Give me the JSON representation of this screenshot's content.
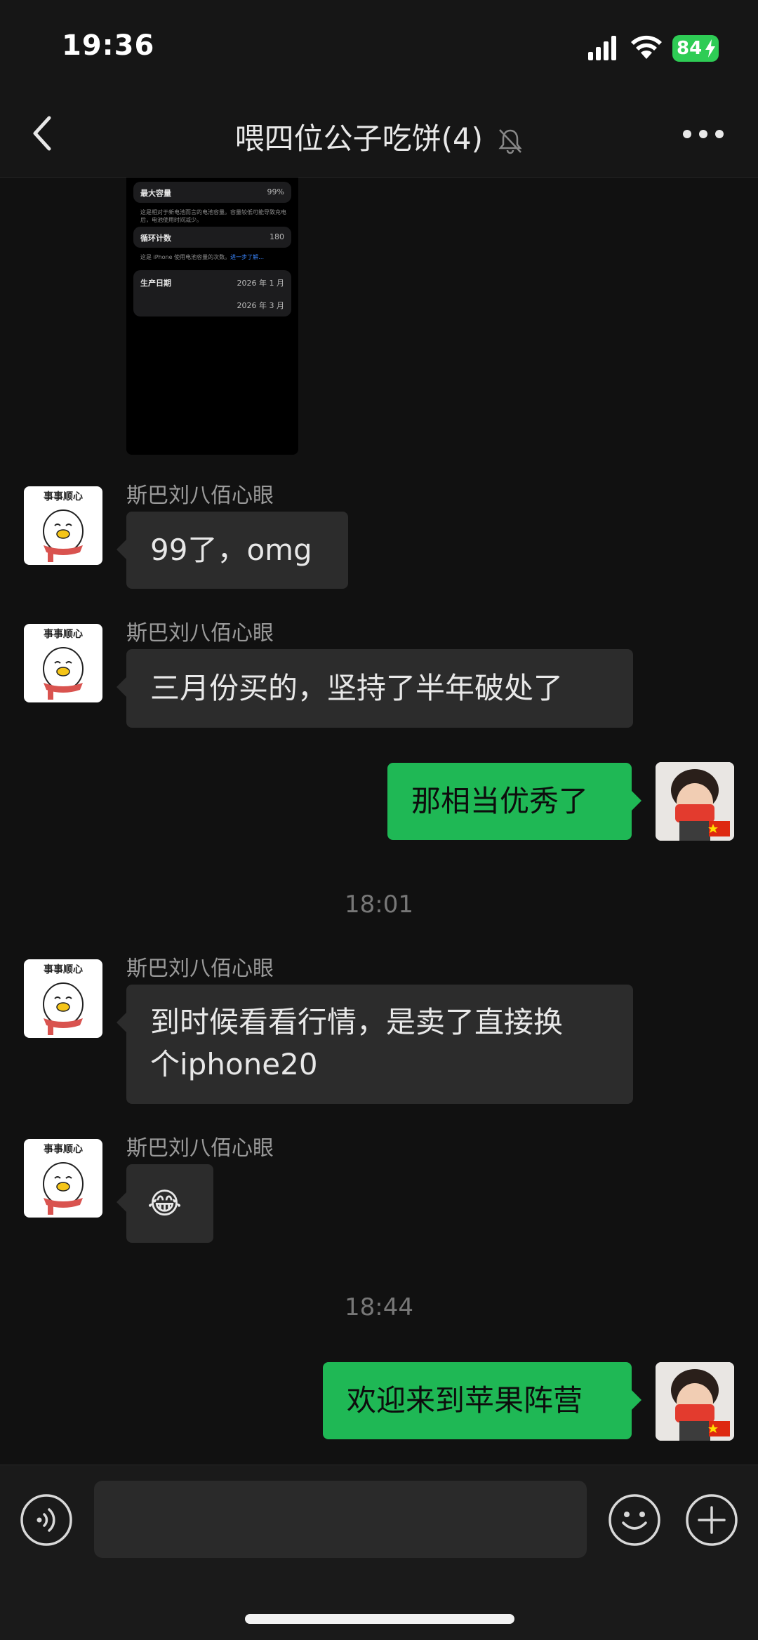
{
  "status": {
    "time": "19:36",
    "battery": "84"
  },
  "header": {
    "title": "喂四位公子吃饼(4)"
  },
  "screenshot": {
    "rows": [
      {
        "label": "最大容量",
        "value": "99%",
        "desc": "这是相对于新电池而言的电池容量。容量较低可能导致充电后，电池使用时间减少。"
      },
      {
        "label": "循环计数",
        "value": "180",
        "desc": "这是 iPhone 使用电池容量的次数。",
        "link": "进一步了解…"
      },
      {
        "label": "生产日期",
        "value": "2026 年 1 月"
      },
      {
        "label": "",
        "value": "2026 年 3 月"
      }
    ]
  },
  "messages": [
    {
      "sender": "斯巴刘八佰心眼",
      "avatar_text": "事事顺心",
      "text": "99了，omg"
    },
    {
      "sender": "斯巴刘八佰心眼",
      "avatar_text": "事事顺心",
      "text": "三月份买的，坚持了半年破处了"
    },
    {
      "outgoing": true,
      "text": "那相当优秀了"
    },
    {
      "timestamp": "18:01"
    },
    {
      "sender": "斯巴刘八佰心眼",
      "avatar_text": "事事顺心",
      "text_line1": "到时候看看行情，是卖了直接换",
      "text_line2": "个iphone20"
    },
    {
      "sender": "斯巴刘八佰心眼",
      "avatar_text": "事事顺心",
      "text": "😂"
    },
    {
      "timestamp": "18:44"
    },
    {
      "outgoing": true,
      "text": "欢迎来到苹果阵营"
    }
  ],
  "input": {
    "value": ""
  },
  "colors": {
    "outgoing_bubble": "#1fb855",
    "incoming_bubble": "#2c2c2c",
    "background": "#111111"
  }
}
